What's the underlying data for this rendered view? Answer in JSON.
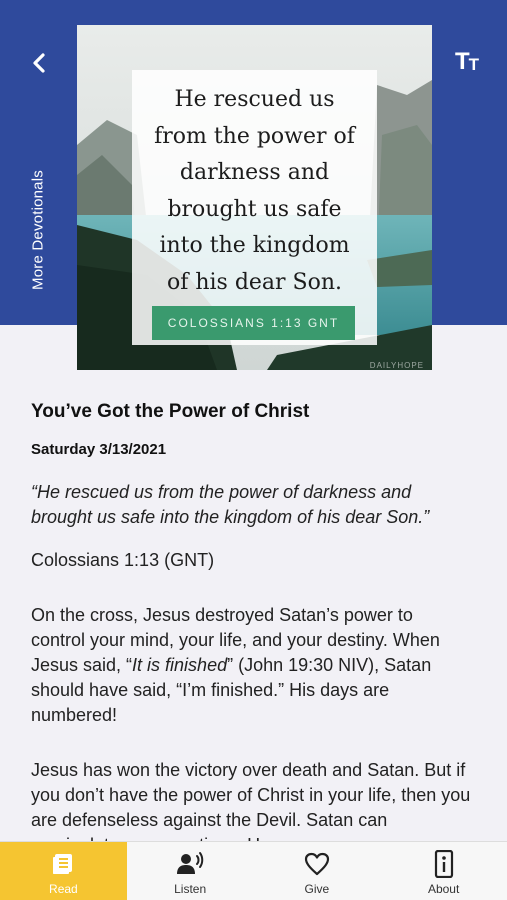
{
  "header": {
    "more_devotionals_label": "More Devotionals",
    "text_size_big": "T",
    "text_size_small": "T"
  },
  "hero": {
    "quote_lines": [
      "He rescued us",
      "from the power of",
      "darkness and",
      "brought us safe",
      "into the kingdom",
      "of his dear Son."
    ],
    "reference_badge": "COLOSSIANS 1:13 GNT",
    "watermark": "DAILYHOPE"
  },
  "devotional": {
    "title": "You’ve Got the Power of Christ",
    "date": "Saturday 3/13/2021",
    "verse": "“He rescued us from the power of darkness and brought us safe into the kingdom of his dear Son.”",
    "reference": "Colossians 1:13 (GNT)",
    "paragraph1_before": "On the cross, Jesus destroyed Satan’s power to control your mind, your life, and your destiny. When Jesus said, “",
    "paragraph1_italic": "It is finished",
    "paragraph1_after": "” (John 19:30 NIV), Satan should have said, “I’m finished.” His days are numbered!",
    "paragraph2": "Jesus has won the victory over death and Satan. But if you don’t have the power of Christ in your life, then you are defenseless against the Devil. Satan can manipulate your emotions. He can"
  },
  "tabs": [
    {
      "label": "Read",
      "icon": "book-icon",
      "active": true
    },
    {
      "label": "Listen",
      "icon": "speaker-icon",
      "active": false
    },
    {
      "label": "Give",
      "icon": "heart-icon",
      "active": false
    },
    {
      "label": "About",
      "icon": "info-icon",
      "active": false
    }
  ],
  "colors": {
    "header_blue": "#2f4a9c",
    "badge_green": "#3a9a6e",
    "active_tab": "#f5c531",
    "background": "#f2f1f6"
  }
}
